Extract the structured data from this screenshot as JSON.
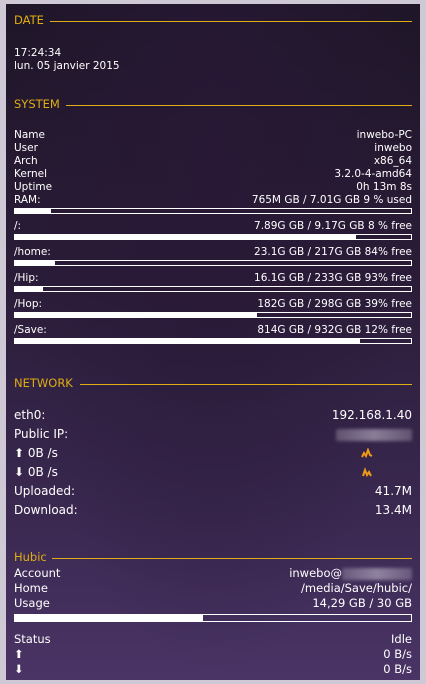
{
  "date": {
    "title": "DATE",
    "time": "17:24:34",
    "day": "lun. 05 janvier 2015"
  },
  "system": {
    "title": "SYSTEM",
    "info": [
      {
        "label": "Name",
        "value": "inwebo-PC"
      },
      {
        "label": "User",
        "value": "inwebo"
      },
      {
        "label": "Arch",
        "value": "x86_64"
      },
      {
        "label": "Kernel",
        "value": "3.2.0-4-amd64"
      },
      {
        "label": "Uptime",
        "value": "0h 13m 8s"
      }
    ],
    "ram": {
      "label": "RAM:",
      "value": "765M  GB / 7.01G GB 9  % used",
      "fill": 0.09
    },
    "disks": [
      {
        "label": "/:",
        "value": "7.89G GB / 9.17G GB 8 % free",
        "fill": 0.86
      },
      {
        "label": "/home:",
        "value": "23.1G GB / 217G  GB 84% free",
        "fill": 0.1
      },
      {
        "label": "/Hip:",
        "value": "16.1G GB / 233G  GB 93% free",
        "fill": 0.07
      },
      {
        "label": "/Hop:",
        "value": "182G  GB / 298G  GB 39% free",
        "fill": 0.61
      },
      {
        "label": "/Save:",
        "value": "814G  GB / 932G  GB 12% free",
        "fill": 0.87
      }
    ]
  },
  "network": {
    "title": "NETWORK",
    "iface_label": "eth0:",
    "iface_ip": "192.168.1.40",
    "public_ip_label": "Public IP:",
    "up_label": "⬆ 0B   /s",
    "down_label": "⬇ 0B   /s",
    "uploaded_label": "Uploaded:",
    "uploaded_value": "41.7M",
    "download_label": "Download:",
    "download_value": "13.4M",
    "graph_color": "#f09a18"
  },
  "hubic": {
    "title": "Hubic",
    "account_label": "Account",
    "account_value": "inwebo@",
    "home_label": "Home",
    "home_value": "/media/Save/hubic/",
    "usage_label": "Usage",
    "usage_value": "14,29 GB /  30 GB",
    "usage_fill": 0.476,
    "status_label": "Status",
    "status_value": "Idle",
    "up_icon": "⬆",
    "up_value": "0 B/s",
    "down_icon": "⬇",
    "down_value": "0 B/s"
  },
  "colors": {
    "accent": "#e0ad14",
    "text": "#ffffff"
  }
}
